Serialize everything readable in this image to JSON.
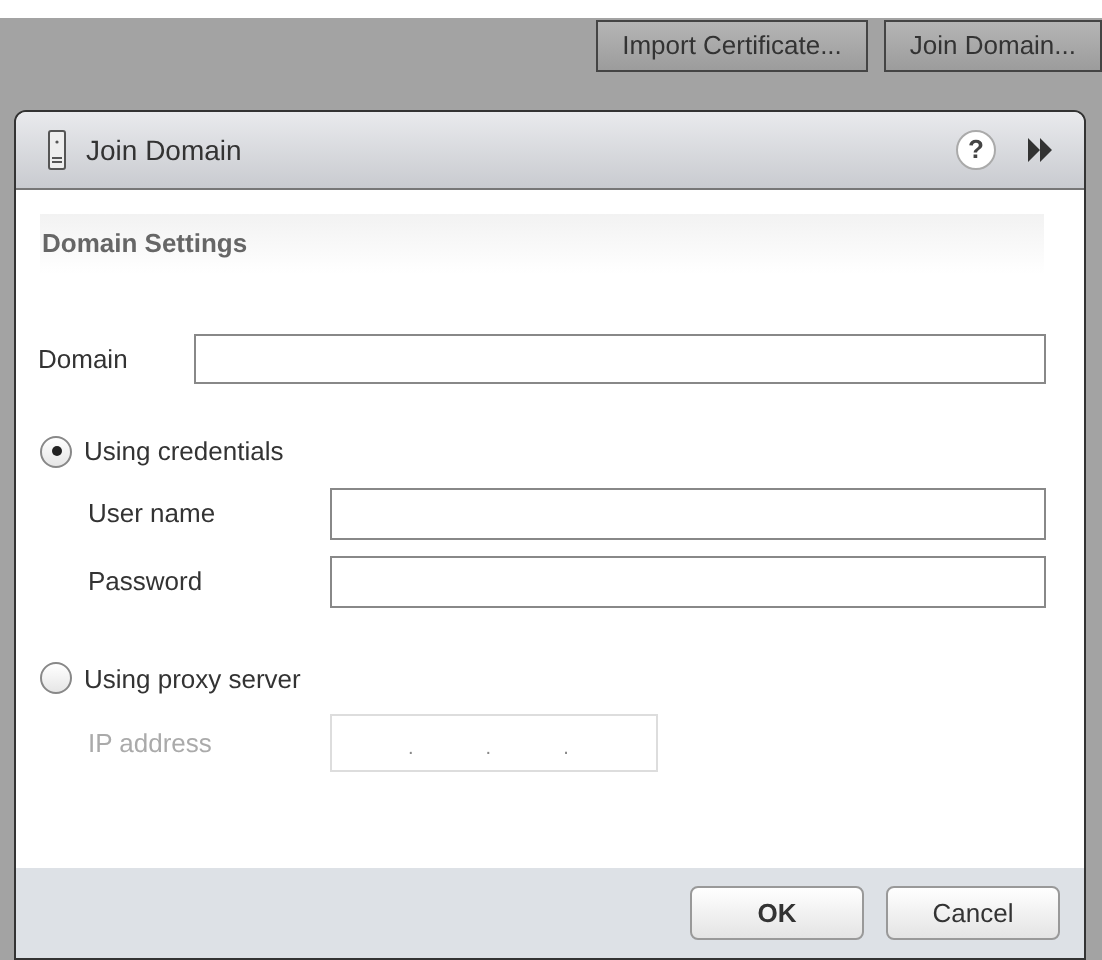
{
  "toolbar": {
    "buttons": [
      "Import Certificate...",
      "Join Domain..."
    ]
  },
  "dialog": {
    "title": "Join Domain",
    "help": "?",
    "section_title": "Domain Settings",
    "domain": {
      "label": "Domain"
    },
    "options": [
      {
        "label": "Using credentials",
        "selected": true,
        "fields": [
          {
            "label": "User name",
            "kind": "text",
            "disabled": false
          },
          {
            "label": "Password",
            "kind": "text",
            "disabled": false
          }
        ]
      },
      {
        "label": "Using proxy server",
        "selected": false,
        "fields": [
          {
            "label": "IP address",
            "kind": "ip",
            "disabled": true,
            "separators": [
              ".",
              ".",
              "."
            ]
          }
        ]
      }
    ],
    "buttons": [
      "OK",
      "Cancel"
    ]
  }
}
